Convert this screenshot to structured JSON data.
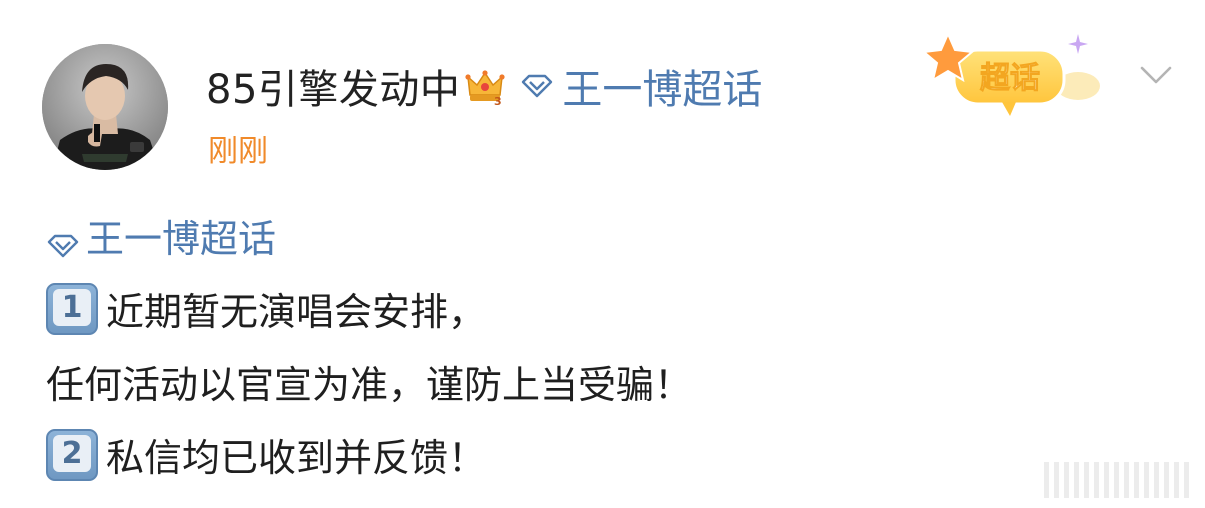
{
  "post": {
    "author": {
      "name": "85引擎发动中",
      "avatar_icon": "avatar-photo",
      "vip_badge_icon": "vip-crown-badge-icon"
    },
    "header_topic": {
      "icon": "diamond-icon",
      "label": "王一博超话"
    },
    "timestamp": "刚刚",
    "supertopic_badge": {
      "label": "超话",
      "icon": "star-supertopic-icon"
    },
    "menu_icon": "chevron-down-icon",
    "content": {
      "topic": {
        "icon": "diamond-icon",
        "label": "王一博超话"
      },
      "items": [
        {
          "keycap": "1",
          "text": "近期暂无演唱会安排，"
        },
        {
          "keycap": "",
          "text": "任何活动以官宣为准，谨防上当受骗！"
        },
        {
          "keycap": "2",
          "text": "私信均已收到并反馈！"
        }
      ]
    }
  },
  "colors": {
    "link_blue": "#4f7bb0",
    "timestamp_orange": "#f08a2a",
    "text_dark": "#1f1f1f",
    "badge_yellow": "#ffd257"
  }
}
